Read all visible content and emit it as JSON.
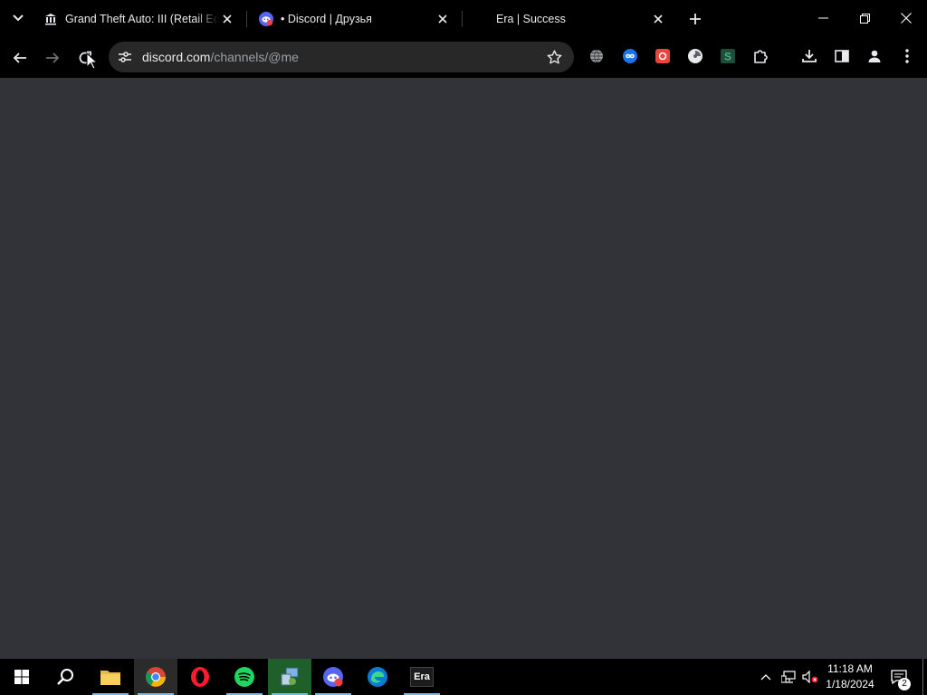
{
  "browser": {
    "tabs": [
      {
        "title": "Grand Theft Auto: III (Retail Edition)",
        "favicon": "museum-icon",
        "active": false
      },
      {
        "title": "• Discord | Друзья",
        "favicon": "discord-icon",
        "active": true
      },
      {
        "title": "Era | Success",
        "favicon": "blank",
        "active": false
      }
    ],
    "url": {
      "host": "discord.com",
      "path": "/channels/@me"
    },
    "extensions": [
      "globe-icon",
      "infinity-icon",
      "red-square-icon",
      "pie-icon",
      "s-icon",
      "puzzle-icon"
    ]
  },
  "taskbar": {
    "apps": [
      "file-explorer",
      "chrome",
      "opera",
      "spotify",
      "control-panel",
      "discord",
      "edge",
      "era"
    ],
    "era_label": "Era",
    "clock": {
      "time": "11:18 AM",
      "date": "1/18/2024"
    },
    "notification_count": "2"
  },
  "colors": {
    "content_bg": "#313338",
    "omnibox_bg": "#282828",
    "chrome_bg": "#000000",
    "taskbar_accent": "#76b9ed"
  }
}
